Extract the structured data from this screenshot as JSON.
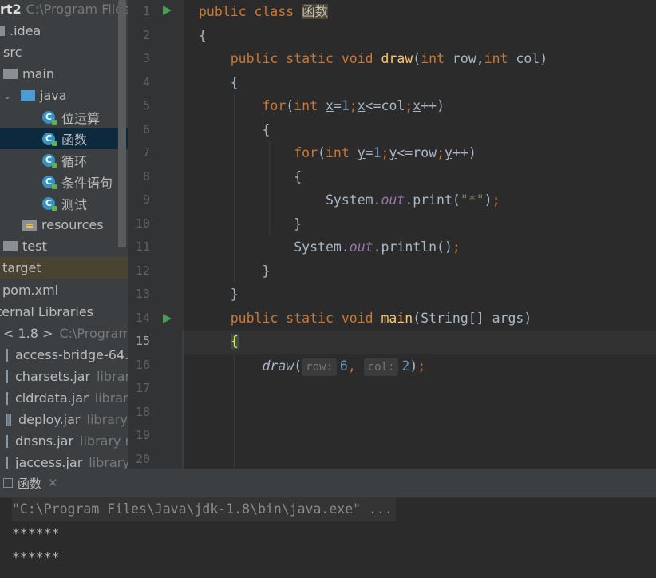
{
  "project": {
    "title": "rt2",
    "path": "C:\\Program Files\\"
  },
  "tree": [
    {
      "label": ".idea",
      "sub": "",
      "kind": "folder-gray"
    },
    {
      "label": "src",
      "sub": "",
      "kind": "none"
    },
    {
      "label": "main",
      "sub": "",
      "kind": "folder-gray"
    },
    {
      "label": "java",
      "sub": "",
      "kind": "folder-blue"
    },
    {
      "label": "位运算",
      "sub": "",
      "kind": "class"
    },
    {
      "label": "函数",
      "sub": "",
      "kind": "class",
      "selected": true
    },
    {
      "label": "循环",
      "sub": "",
      "kind": "class"
    },
    {
      "label": "条件语句",
      "sub": "",
      "kind": "class"
    },
    {
      "label": "测试",
      "sub": "",
      "kind": "class"
    },
    {
      "label": "resources",
      "sub": "",
      "kind": "resources"
    },
    {
      "label": "test",
      "sub": "",
      "kind": "folder-gray"
    },
    {
      "label": "target",
      "sub": "",
      "kind": "none"
    },
    {
      "label": "pom.xml",
      "sub": "",
      "kind": "none"
    },
    {
      "label": "ternal Libraries",
      "sub": "",
      "kind": "none"
    },
    {
      "label": "< 1.8 >",
      "sub": "C:\\Program",
      "kind": "none"
    },
    {
      "label": "access-bridge-64.",
      "sub": "",
      "kind": "jar"
    },
    {
      "label": "charsets.jar",
      "sub": "librar",
      "kind": "jar"
    },
    {
      "label": "cldrdata.jar",
      "sub": "librar",
      "kind": "jar"
    },
    {
      "label": "deploy.jar",
      "sub": "library",
      "kind": "jar"
    },
    {
      "label": "dnsns.jar",
      "sub": "library r",
      "kind": "jar"
    },
    {
      "label": "jaccess.jar",
      "sub": "library",
      "kind": "jar"
    }
  ],
  "line_numbers": [
    "1",
    "2",
    "3",
    "4",
    "5",
    "6",
    "7",
    "8",
    "9",
    "10",
    "11",
    "12",
    "13",
    "14",
    "15",
    "16",
    "17",
    "18",
    "19",
    "20"
  ],
  "current_line": "15",
  "code": {
    "l1": {
      "kw": "public class ",
      "name": "函数"
    },
    "l2": "{",
    "l3": {
      "kw": "public static void ",
      "fn": "draw",
      "open": "(",
      "kw2": "int",
      "p1": " row,",
      "kw3": "int",
      "p2": " col)"
    },
    "l4": "{",
    "l5": {
      "kw": "for",
      "a": "(",
      "kw2": "int ",
      "v1": "x",
      "eq": "=",
      "n1": "1",
      "s1": ";",
      "v2": "x",
      "cmp": "<=col",
      "s2": ";",
      "v3": "x",
      "inc": "++)"
    },
    "l6": "{",
    "l7": {
      "kw": "for",
      "a": "(",
      "kw2": "int ",
      "v1": "y",
      "eq": "=",
      "n1": "1",
      "s1": ";",
      "v2": "y",
      "cmp": "<=row",
      "s2": ";",
      "v3": "y",
      "inc": "++)"
    },
    "l8": "{",
    "l9": {
      "cls": "System.",
      "out": "out",
      "call": ".print(",
      "str": "\"*\"",
      "end": ")",
      "semi": ";"
    },
    "l10": "}",
    "l11": {
      "cls": "System.",
      "out": "out",
      "call": ".println()",
      "semi": ";"
    },
    "l12": "}",
    "l13": "}",
    "l14": {
      "kw": "public static void ",
      "fn": "main",
      "rest": "(String[] args)"
    },
    "l15": "{",
    "l16": {
      "fn": "draw",
      "open": "(",
      "h1": "row:",
      "n1": "6",
      "comma": ",",
      "h2": "col:",
      "n2": "2",
      "close": ")",
      "semi": ";"
    }
  },
  "console": {
    "tab_label": "函数",
    "command": "\"C:\\Program Files\\Java\\jdk-1.8\\bin\\java.exe\" ...",
    "output": [
      "******",
      "******"
    ]
  },
  "colors": {
    "keyword": "#cc7832",
    "function": "#ffc66d",
    "number": "#6897bb",
    "string": "#6a8759",
    "static_field": "#9876aa",
    "text": "#a9b7c6"
  }
}
